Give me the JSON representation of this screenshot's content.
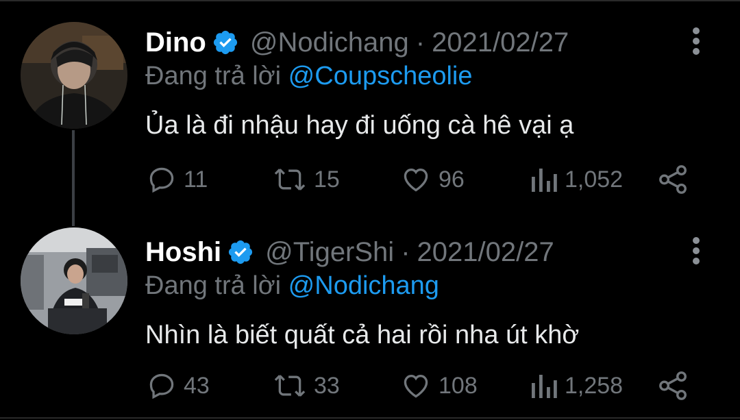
{
  "colors": {
    "background": "#000000",
    "text_primary": "#ffffff",
    "text_secondary": "#71767b",
    "mention": "#1d9bf0",
    "verified_badge": "#1d9bf0"
  },
  "tweets": [
    {
      "display_name": "Dino",
      "handle": "@Nodichang",
      "separator": "·",
      "date": "2021/02/27",
      "reply_prefix": "Đang trả lời",
      "reply_to": "@Coupscheolie",
      "text": "Ủa là đi nhậu hay đi uống cà hê vại ạ",
      "verified": true,
      "avatar_icon": "avatar-dino",
      "stats": {
        "replies": "11",
        "retweets": "15",
        "likes": "96",
        "views": "1,052"
      }
    },
    {
      "display_name": "Hoshi",
      "handle": "@TigerShi",
      "separator": "·",
      "date": "2021/02/27",
      "reply_prefix": "Đang trả lời",
      "reply_to": "@Nodichang",
      "text": "Nhìn là biết quất cả hai rồi nha út khờ",
      "verified": true,
      "avatar_icon": "avatar-hoshi",
      "stats": {
        "replies": "43",
        "retweets": "33",
        "likes": "108",
        "views": "1,258"
      }
    }
  ]
}
